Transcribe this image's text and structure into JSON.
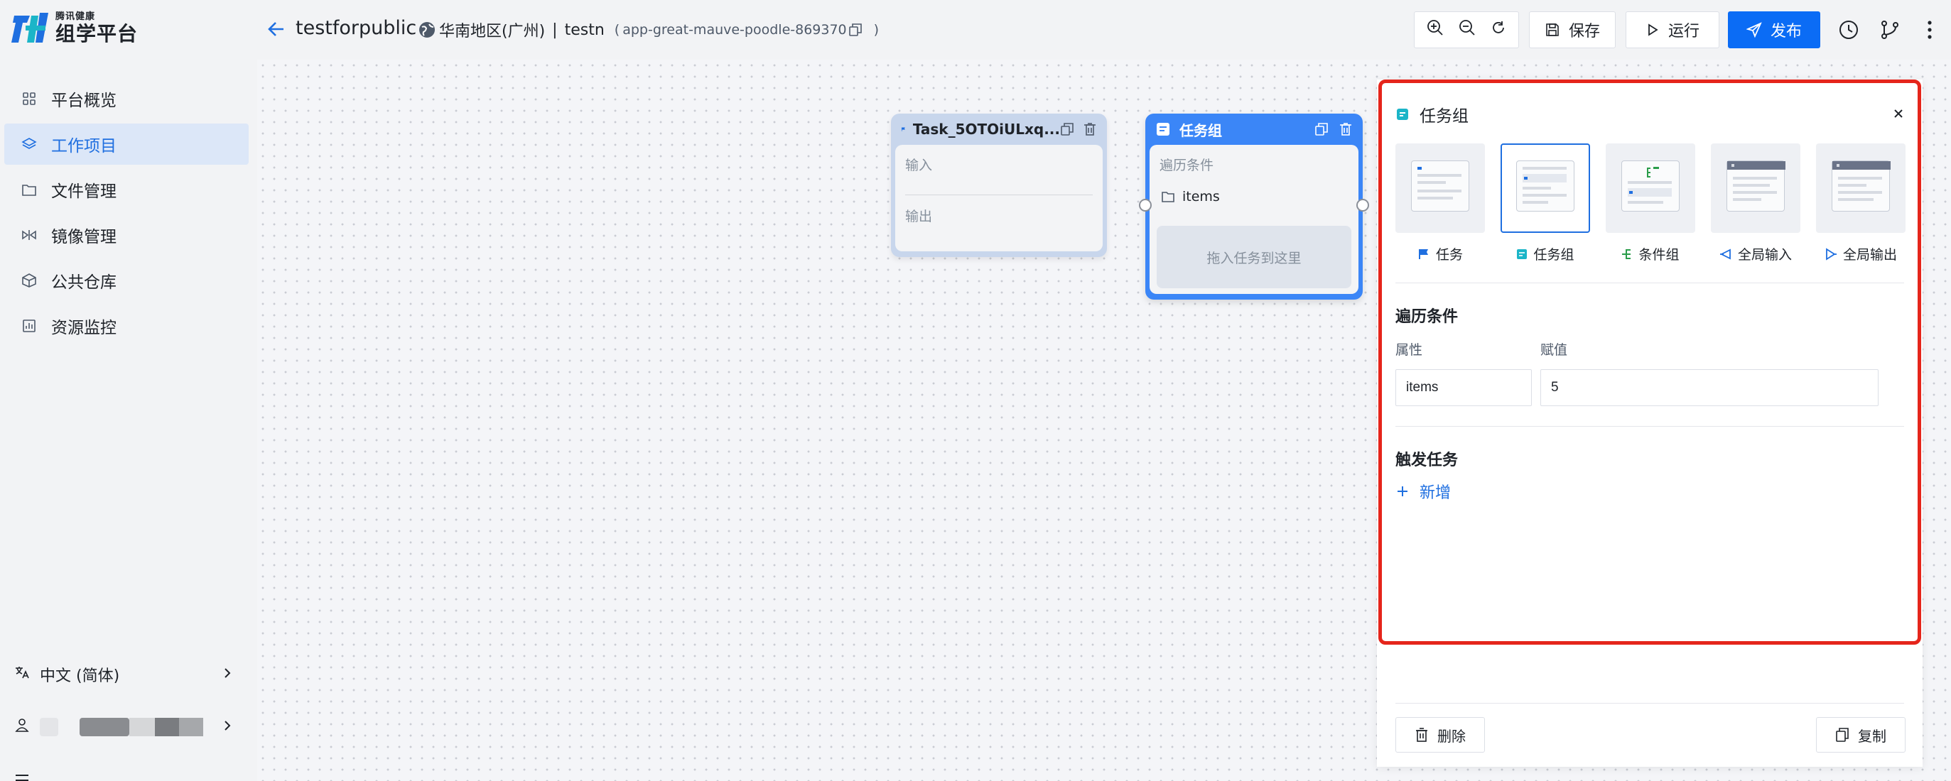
{
  "brand": {
    "small": "腾讯健康",
    "big": "组学平台",
    "colors": {
      "blue": "#1f6fe0",
      "teal": "#1bb5c8"
    }
  },
  "sidebar": {
    "items": [
      {
        "label": "平台概览",
        "icon": "grid-icon"
      },
      {
        "label": "工作项目",
        "icon": "layers-icon",
        "active": true
      },
      {
        "label": "文件管理",
        "icon": "folder-icon"
      },
      {
        "label": "镜像管理",
        "icon": "mirror-icon"
      },
      {
        "label": "公共仓库",
        "icon": "cube-icon"
      },
      {
        "label": "资源监控",
        "icon": "chart-icon"
      }
    ],
    "language": "中文 (简体)"
  },
  "header": {
    "project": "testforpublic",
    "region": "华南地区(广州)",
    "separator": "|",
    "app_name": "testn",
    "app_id_open": "(",
    "app_id": "app-great-mauve-poodle-869370",
    "app_id_close": ")",
    "save": "保存",
    "run": "运行",
    "publish": "发布"
  },
  "canvas": {
    "task_node": {
      "title": "Task_5OTOiULxq...",
      "input": "输入",
      "output": "输出"
    },
    "group_node": {
      "title": "任务组",
      "condition": "遍历条件",
      "item": "items",
      "drop_hint": "拖入任务到这里"
    }
  },
  "panel": {
    "title": "任务组",
    "types": [
      {
        "label": "任务",
        "icon": "flag-icon"
      },
      {
        "label": "任务组",
        "icon": "group-icon",
        "selected": true
      },
      {
        "label": "条件组",
        "icon": "branch-icon"
      },
      {
        "label": "全局输入",
        "icon": "global-input-icon"
      },
      {
        "label": "全局输出",
        "icon": "global-output-icon"
      }
    ],
    "condition_title": "遍历条件",
    "attr_label": "属性",
    "value_label": "赋值",
    "attr_value": "items",
    "value_value": "5",
    "trigger_title": "触发任务",
    "add": "新增",
    "delete": "删除",
    "copy": "复制"
  }
}
